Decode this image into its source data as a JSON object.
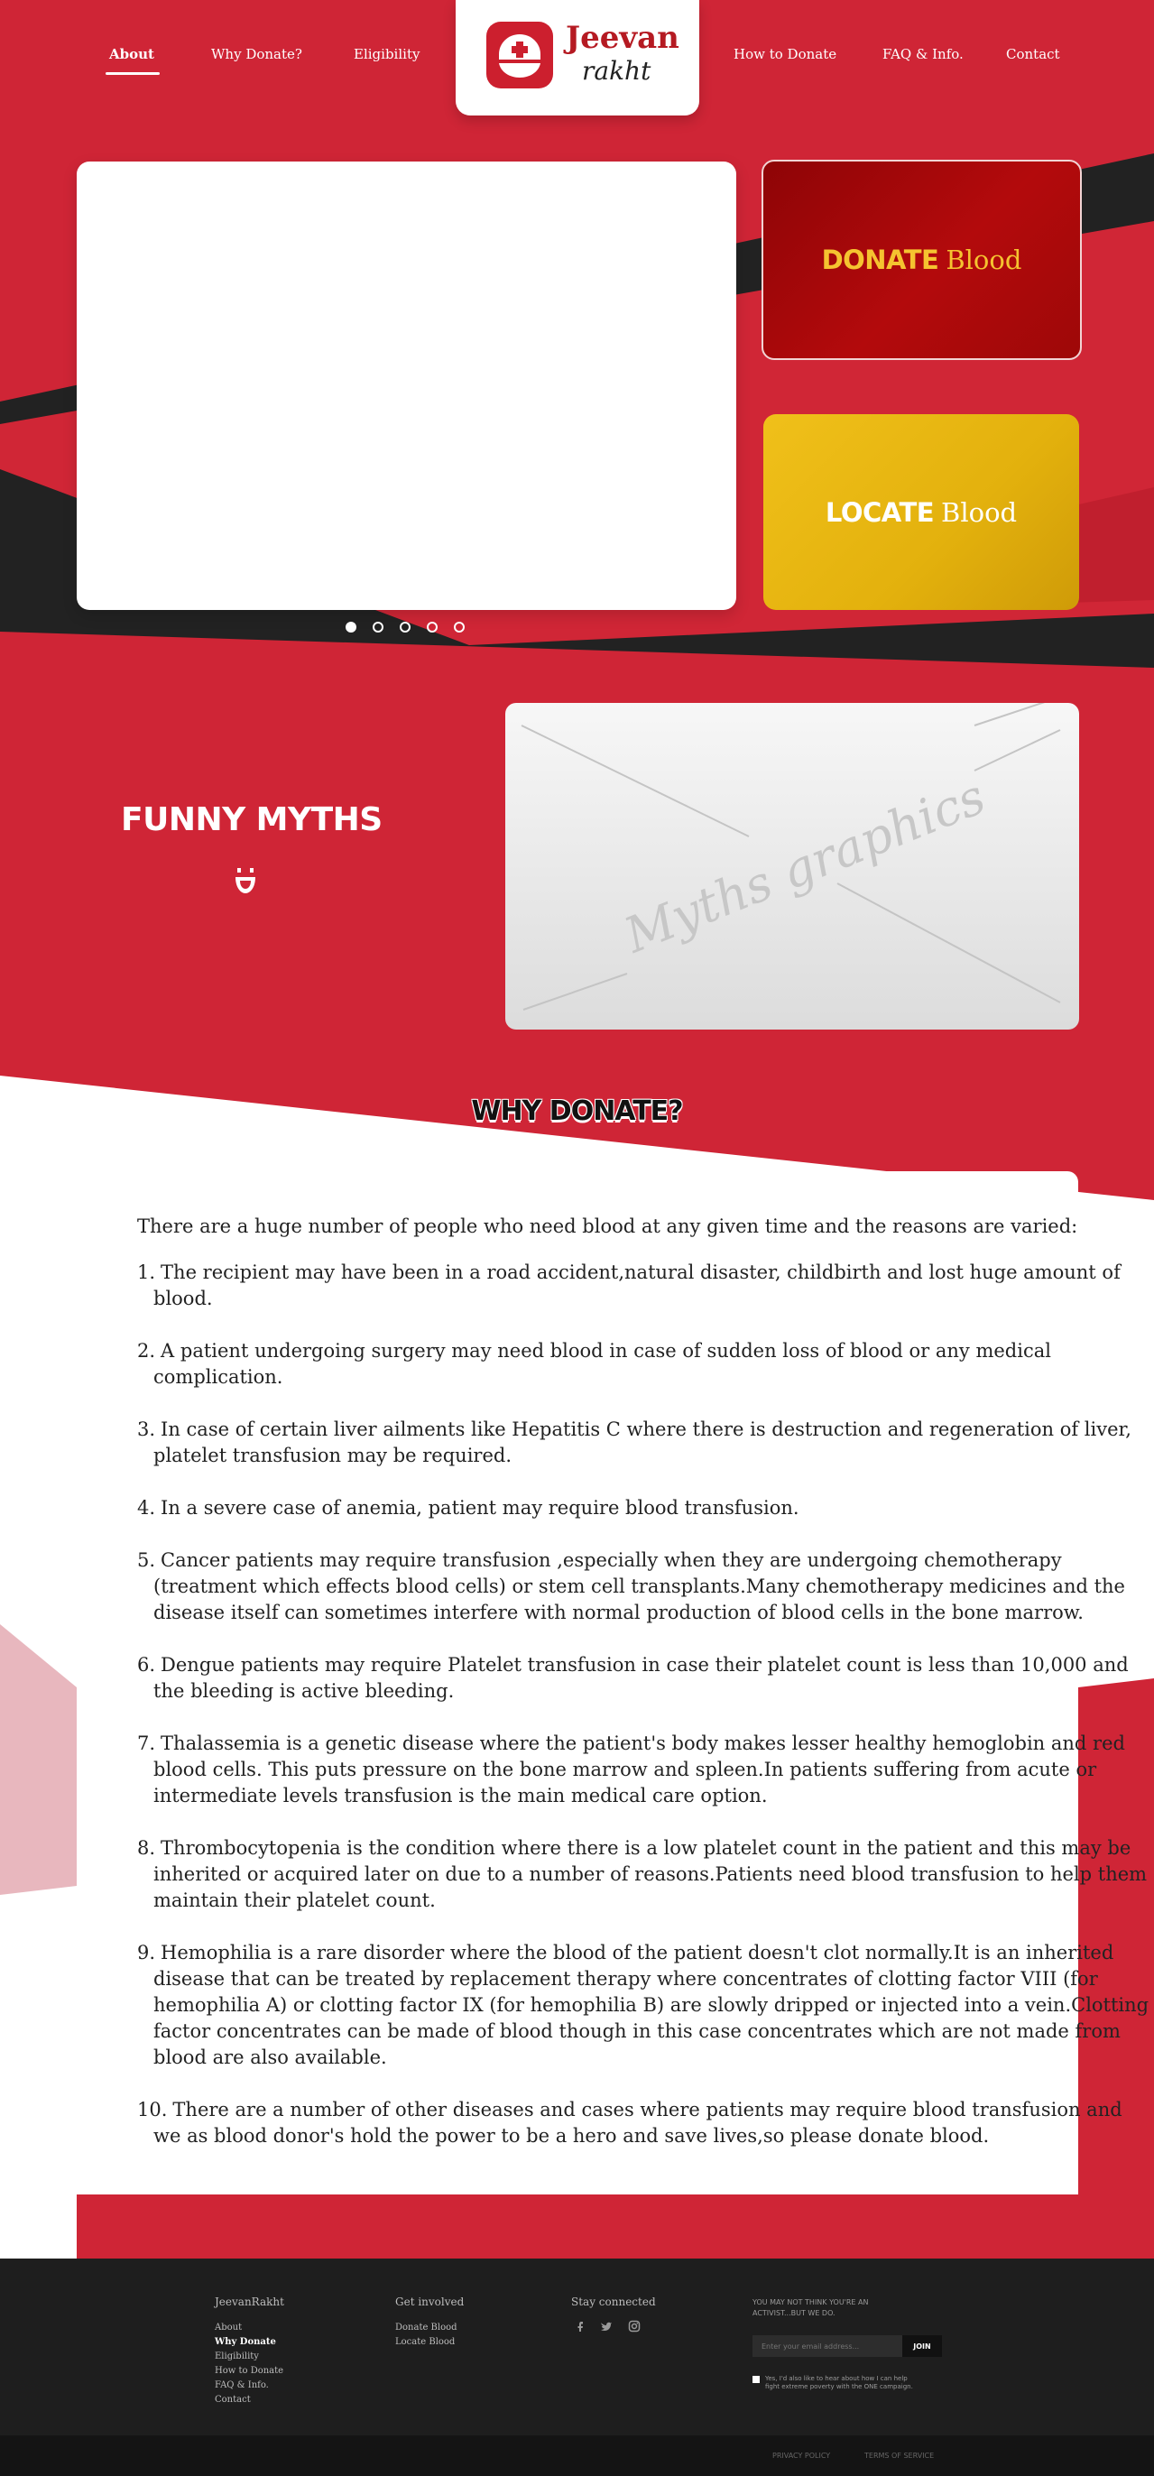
{
  "nav": {
    "left": [
      "About",
      "Why Donate?",
      "Eligibility"
    ],
    "right": [
      "How to Donate",
      "FAQ & Info.",
      "Contact"
    ]
  },
  "logo": {
    "line1": "Jeevan",
    "line2": "rakht"
  },
  "promos": {
    "donate": {
      "strong": "DONATE",
      "light": "Blood"
    },
    "locate": {
      "strong": "LOCATE",
      "light": "Blood"
    }
  },
  "slider": {
    "count": 5,
    "active": 1
  },
  "myths": {
    "title": "FUNNY MYTHS",
    "placeholder": "Myths graphics"
  },
  "why": {
    "title": "WHY DONATE?",
    "intro": "There are a huge number of people who need blood at any given time and the reasons are varied:",
    "items": [
      "The recipient may have been in a road accident,natural disaster, childbirth and lost huge amount of blood.",
      "A patient undergoing surgery may need blood in case of sudden loss of blood or any medical complication.",
      "In case of certain liver ailments like Hepatitis C where there is destruction and regeneration of liver, platelet transfusion may be required.",
      "In a severe case of anemia, patient may require blood transfusion.",
      "Cancer patients may require transfusion ,especially when they are undergoing chemotherapy (treatment which effects blood cells) or stem cell transplants.Many chemotherapy medicines and the disease itself can sometimes interfere with normal production of blood cells in the bone marrow.",
      "Dengue patients may require Platelet transfusion in case their platelet count is less than 10,000 and the bleeding is active bleeding.",
      "Thalassemia is a genetic disease where the patient's body makes lesser healthy hemoglobin and red blood cells. This puts pressure on the bone marrow and spleen.In patients suffering from acute or intermediate levels transfusion is the main medical care option.",
      "Thrombocytopenia is the condition where there is a low platelet count in the patient and this may be inherited or acquired later on due to a number of reasons.Patients need blood transfusion to help them maintain their platelet count.",
      "Hemophilia is a rare disorder where the blood of the patient doesn't clot normally.It is an inherited disease that can be treated by replacement therapy where concentrates of clotting factor VIII (for hemophilia A) or clotting factor IX (for hemophilia B) are slowly dripped or injected into a vein.Clotting factor concentrates can be made of blood though in this case concentrates which are not made from blood are also available.",
      "There are a number of other diseases and cases where patients may require blood transfusion and we as blood donor's hold the power to be a hero and save lives,so please donate blood."
    ]
  },
  "footer": {
    "col1": {
      "head": "JeevanRakht",
      "links": [
        "About",
        "Why Donate",
        "Eligibility",
        "How to Donate",
        "FAQ & Info.",
        "Contact"
      ],
      "active_index": 1
    },
    "col2": {
      "head": "Get involved",
      "links": [
        "Donate Blood",
        "Locate Blood"
      ]
    },
    "col3": {
      "head": "Stay connected",
      "icons": [
        "facebook-icon",
        "twitter-icon",
        "instagram-icon"
      ]
    },
    "signup": {
      "tagline_1": "YOU MAY NOT THINK YOU'RE AN",
      "tagline_2": "ACTIVIST...BUT WE DO.",
      "email_placeholder": "Enter your email address...",
      "join": "JOIN",
      "consent_1": "Yes, I'd also like to hear about how I can help",
      "consent_2": "fight extreme poverty with the ONE campaign."
    },
    "bottom": {
      "privacy": "PRIVACY POLICY",
      "terms": "TERMS OF SERVICE"
    }
  },
  "colors": {
    "brand_red": "#cf2536",
    "dark": "#1e1e1e",
    "gold": "#f5c330"
  }
}
